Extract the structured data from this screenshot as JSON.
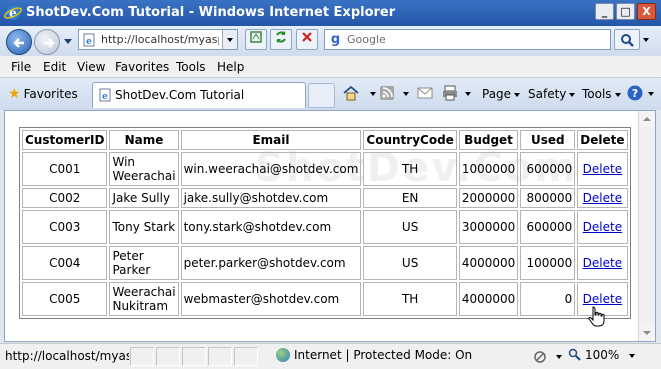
{
  "window": {
    "title": "ShotDev.Com Tutorial - Windows Internet Explorer",
    "minimize": "_",
    "maximize": "□",
    "close": "X"
  },
  "address": {
    "url": "http://localhost/myasp/a",
    "search_placeholder": "Google",
    "search_engine_letter": "g"
  },
  "menu": {
    "items": [
      "File",
      "Edit",
      "View",
      "Favorites",
      "Tools",
      "Help"
    ]
  },
  "tabbar": {
    "favorites_label": "Favorites",
    "tab_label": "ShotDev.Com Tutorial",
    "commands": [
      "Page",
      "Safety",
      "Tools"
    ]
  },
  "table": {
    "headers": [
      "CustomerID",
      "Name",
      "Email",
      "CountryCode",
      "Budget",
      "Used",
      "Delete"
    ],
    "rows": [
      {
        "id": "C001",
        "name": "Win Weerachai",
        "email": "win.weerachai@shotdev.com",
        "cc": "TH",
        "budget": "1000000",
        "used": "600000",
        "del": "Delete"
      },
      {
        "id": "C002",
        "name": "Jake Sully",
        "email": "jake.sully@shotdev.com",
        "cc": "EN",
        "budget": "2000000",
        "used": "800000",
        "del": "Delete"
      },
      {
        "id": "C003",
        "name": "Tony Stark",
        "email": "tony.stark@shotdev.com",
        "cc": "US",
        "budget": "3000000",
        "used": "600000",
        "del": "Delete"
      },
      {
        "id": "C004",
        "name": "Peter Parker",
        "email": "peter.parker@shotdev.com",
        "cc": "US",
        "budget": "4000000",
        "used": "100000",
        "del": "Delete"
      },
      {
        "id": "C005",
        "name": "Weerachai Nukitram",
        "email": "webmaster@shotdev.com",
        "cc": "TH",
        "budget": "4000000",
        "used": "0",
        "del": "Delete"
      }
    ]
  },
  "watermark": "ShotDev.Com",
  "status": {
    "url": "http://localhost/myasp/as",
    "zone": "Internet | Protected Mode: On",
    "zoom": "100%"
  },
  "colors": {
    "titlebar": "#2b5fae",
    "link": "#0000cc"
  }
}
